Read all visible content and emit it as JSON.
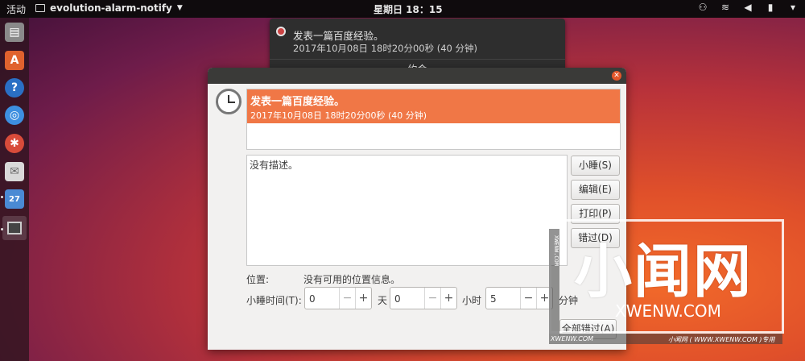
{
  "topbar": {
    "activities": "活动",
    "app_name": "evolution-alarm-notify",
    "clock": "星期日 18：15"
  },
  "notification": {
    "title": "发表一篇百度经验。",
    "time": "2017年10月08日 18时20分00秒 (40 分钟)",
    "action": "约会"
  },
  "dialog": {
    "event": {
      "title": "发表一篇百度经验。",
      "time": "2017年10月08日 18时20分00秒 (40 分钟)",
      "highlight_color": "#f07746"
    },
    "description": "没有描述。",
    "buttons": {
      "snooze": "小睡(S)",
      "edit": "编辑(E)",
      "print": "打印(P)",
      "dismiss": "错过(D)",
      "dismiss_all": "全部错过(A)"
    },
    "location_label": "位置:",
    "location_value": "没有可用的位置信息。",
    "snooze_label": "小睡时间(T):",
    "snooze": {
      "days": "0",
      "days_unit": "天",
      "hours": "0",
      "hours_unit": "小时",
      "minutes": "5",
      "minutes_unit": "分钟"
    }
  },
  "watermark": {
    "big_text": "小闻网",
    "domain": "XWENW.COM",
    "side_text": "XWENW.COM",
    "bottom_left": "XWENW.COM",
    "bottom_right": "小闻网 ( WWW.XWENW.COM )专用"
  }
}
